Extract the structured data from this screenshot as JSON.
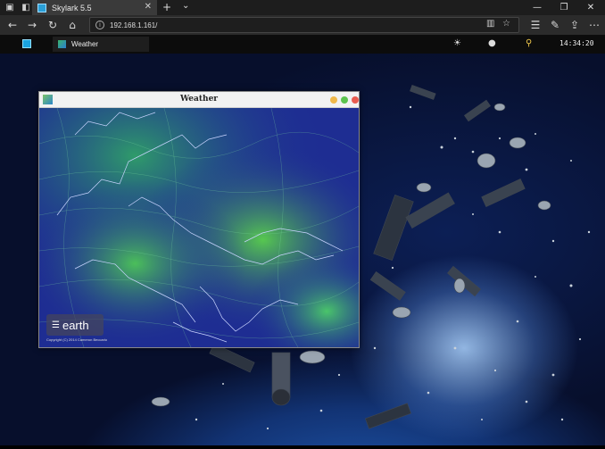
{
  "browser": {
    "tab_title": "Skylark 5.5",
    "url": "192.168.1.161/"
  },
  "taskbar": {
    "app_label": "Weather",
    "clock": "14:34:20"
  },
  "window": {
    "title": "Weather",
    "buttons": {
      "minimize_color": "#f0b84a",
      "maximize_color": "#5cc34e",
      "close_color": "#e85c50"
    }
  },
  "earth": {
    "logo": "earth",
    "copyright": "Copyright (C) 2014 Cameron Beccario"
  },
  "colors": {
    "accent": "#2a9fd6",
    "map_ocean": "#1b2a8c",
    "map_wind": "#5fd35a"
  },
  "icons": [
    "tab-actions-icon",
    "back-icon",
    "forward-icon",
    "refresh-icon",
    "home-icon",
    "info-icon",
    "reading-view-icon",
    "favorite-icon",
    "favorites-hub-icon",
    "pen-icon",
    "share-icon",
    "more-icon",
    "brightness-icon",
    "user-icon",
    "search-icon"
  ]
}
